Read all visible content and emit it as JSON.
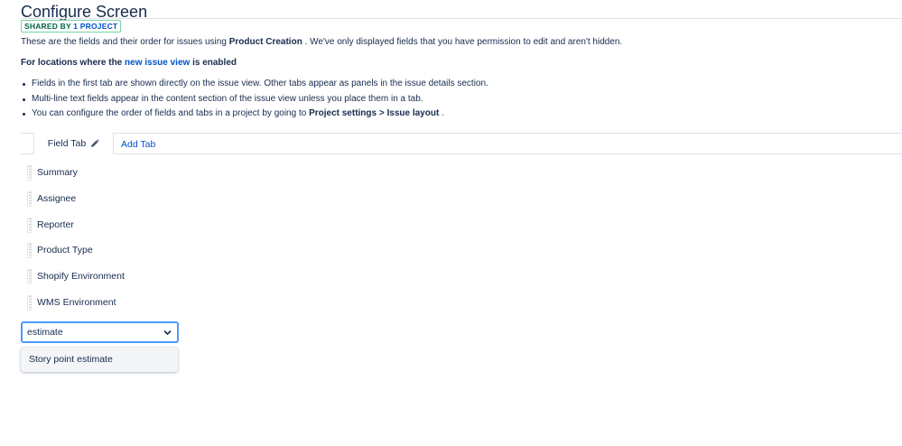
{
  "page": {
    "title": "Configure Screen",
    "badge_prefix": "SHARED BY",
    "badge_count": "1 PROJECT"
  },
  "description": {
    "before": "These are the fields and their order for issues using",
    "project": "Product Creation",
    "after": ". We've only displayed fields that you have permission to edit and aren't hidden."
  },
  "locations": {
    "before": "For locations where the",
    "link": "new issue view",
    "after": "is enabled"
  },
  "bullets": {
    "one": "Fields in the first tab are shown directly on the issue view. Other tabs appear as panels in the issue details section.",
    "two": "Multi-line text fields appear in the content section of the issue view unless you place them in a tab.",
    "three_before": "You can configure the order of fields and tabs in a project by going to",
    "three_bold": "Project settings > Issue layout",
    "three_after": "."
  },
  "tabs": {
    "active": "Field Tab",
    "add": "Add Tab"
  },
  "fields": [
    "Summary",
    "Assignee",
    "Reporter",
    "Product Type",
    "Shopify Environment",
    "WMS Environment"
  ],
  "add_field": {
    "value": "estimate",
    "option": "Story point estimate"
  },
  "colors": {
    "link": "#0052cc",
    "badge_green": "#006644",
    "focus": "#4c9aff",
    "text": "#172b4d"
  },
  "icons": {
    "edit": "pencil-icon",
    "drag": "grip-icon",
    "dropdown": "chevron-down-icon"
  }
}
